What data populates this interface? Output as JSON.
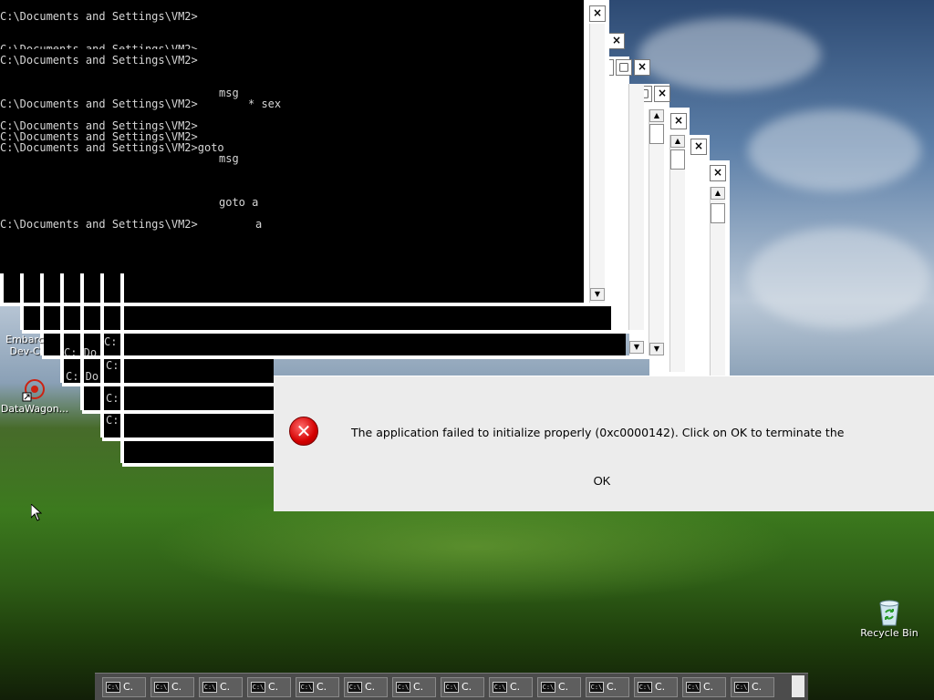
{
  "console": {
    "lines": [
      "C:\\Documents and Settings\\VM2>",
      "C:\\Documents and Settings\\VM2>",
      "C:\\Documents and Settings\\VM2>",
      "msg",
      "C:\\Documents and Settings\\VM2>",
      "* sex",
      "C:\\Documents and Settings\\VM2>",
      "C:\\Documents and Settings\\VM2>",
      "C:\\Documents and Settings\\VM2>goto",
      "msg",
      "goto a",
      "C:\\Documents and Settings\\VM2>",
      "a"
    ]
  },
  "mini_consoles": {
    "labels": [
      "C:",
      "C: Do",
      "C: Do",
      "C:",
      "C:",
      "C:"
    ]
  },
  "desktop_icons": {
    "embarcadero": {
      "label_line1": "Embarc",
      "label_line2": "Dev-C"
    },
    "datawagon": {
      "label": "DataWagon..."
    },
    "recycle_bin": {
      "label": "Recycle Bin"
    }
  },
  "dialog": {
    "message": "The application failed to initialize properly (0xc0000142). Click on OK to terminate the",
    "ok_label": "OK",
    "icon": "error-x-icon"
  },
  "taskbar": {
    "buttons": [
      "C.",
      "C.",
      "C.",
      "C.",
      "C.",
      "C.",
      "C.",
      "C.",
      "C.",
      "C.",
      "C.",
      "C.",
      "C.",
      "C."
    ],
    "icon_glyph": "C:\\"
  },
  "colors": {
    "console_bg": "#000000",
    "dialog_bg": "#ececec",
    "error_red": "#d40000",
    "taskbar_bg": "#4c4c4c"
  }
}
